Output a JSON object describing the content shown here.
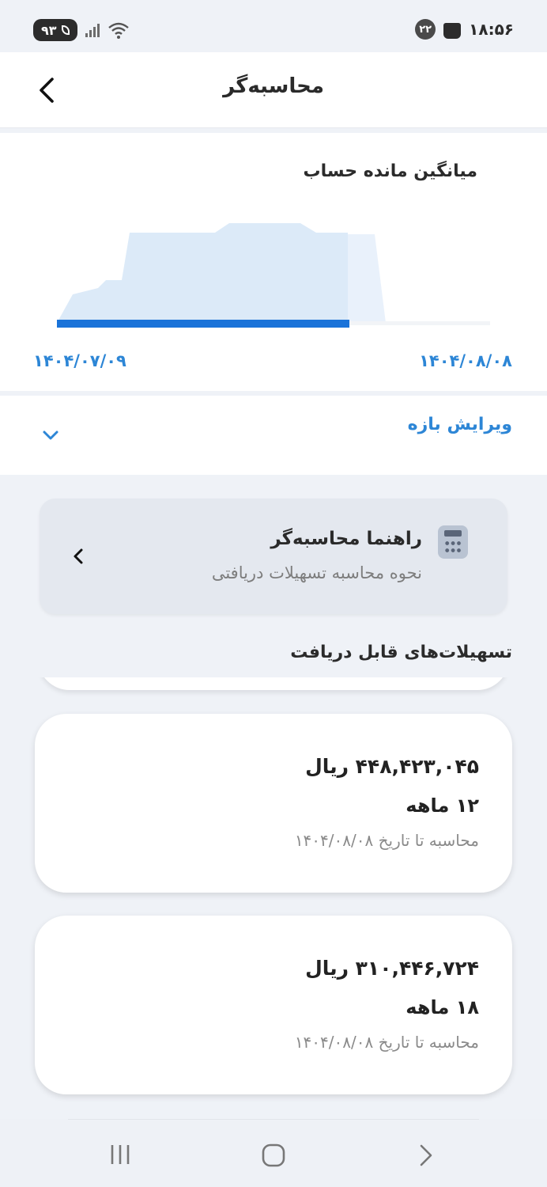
{
  "status_bar": {
    "time": "۱۸:۵۶",
    "notification_count": "۲۲",
    "battery": "۹۳"
  },
  "header": {
    "title": "محاسبه‌گر"
  },
  "chart": {
    "title": "میانگین مانده حساب",
    "date_start": "۱۴۰۴/۰۷/۰۹",
    "date_end": "۱۴۰۴/۰۸/۰۸"
  },
  "chart_data": {
    "type": "area",
    "title": "میانگین مانده حساب",
    "x_start": "۱۴۰۴/۰۷/۰۹",
    "x_end": "۱۴۰۴/۰۸/۰۸",
    "selected_fraction": 0.8,
    "grid": false,
    "legend": "none",
    "colors": {
      "area": "#dceaf8",
      "area_faded": "#e9f1fb",
      "selection": "#1a73d9"
    }
  },
  "edit_range": {
    "label": "ویرایش بازه"
  },
  "guide": {
    "title": "راهنما محاسبه‌گر",
    "subtitle": "نحوه محاسبه تسهیلات دریافتی"
  },
  "section": {
    "title": "تسهیلات‌های قابل دریافت"
  },
  "loans": [
    {
      "amount": "۴۴۸,۴۲۳,۰۴۵ ریال",
      "term": "۱۲ ماهه",
      "date": "محاسبه تا تاریخ ۱۴۰۴/۰۸/۰۸"
    },
    {
      "amount": "۳۱۰,۴۴۶,۷۲۴ ریال",
      "term": "۱۸ ماهه",
      "date": "محاسبه تا تاریخ ۱۴۰۴/۰۸/۰۸"
    }
  ],
  "colors": {
    "accent": "#2d86d6",
    "background": "#eff2f7"
  }
}
